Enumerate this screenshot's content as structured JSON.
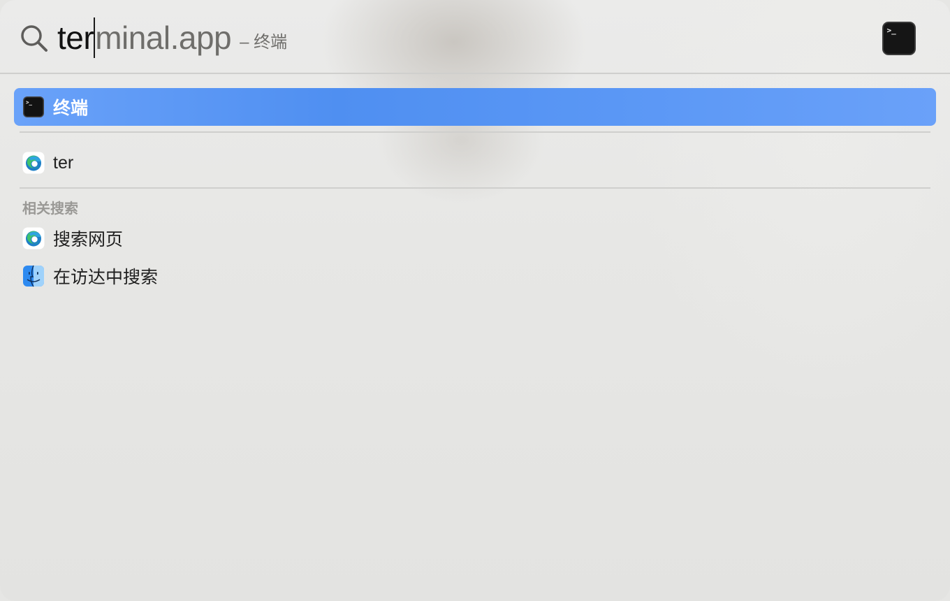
{
  "search": {
    "typed": "ter",
    "completion": "minal.app",
    "hint": "– 终端",
    "preview_icon": "terminal-app-icon"
  },
  "top_hit": {
    "label": "终端",
    "icon": "terminal-app-icon"
  },
  "suggestions": [
    {
      "label": "ter",
      "icon": "edge-browser-icon"
    }
  ],
  "related": {
    "header": "相关搜索",
    "items": [
      {
        "label": "搜索网页",
        "icon": "edge-browser-icon"
      },
      {
        "label": "在访达中搜索",
        "icon": "finder-icon"
      }
    ]
  },
  "colors": {
    "selection": "#4f8ff1",
    "background": "#e6e6e4",
    "completion_text": "#6f6e6b"
  }
}
